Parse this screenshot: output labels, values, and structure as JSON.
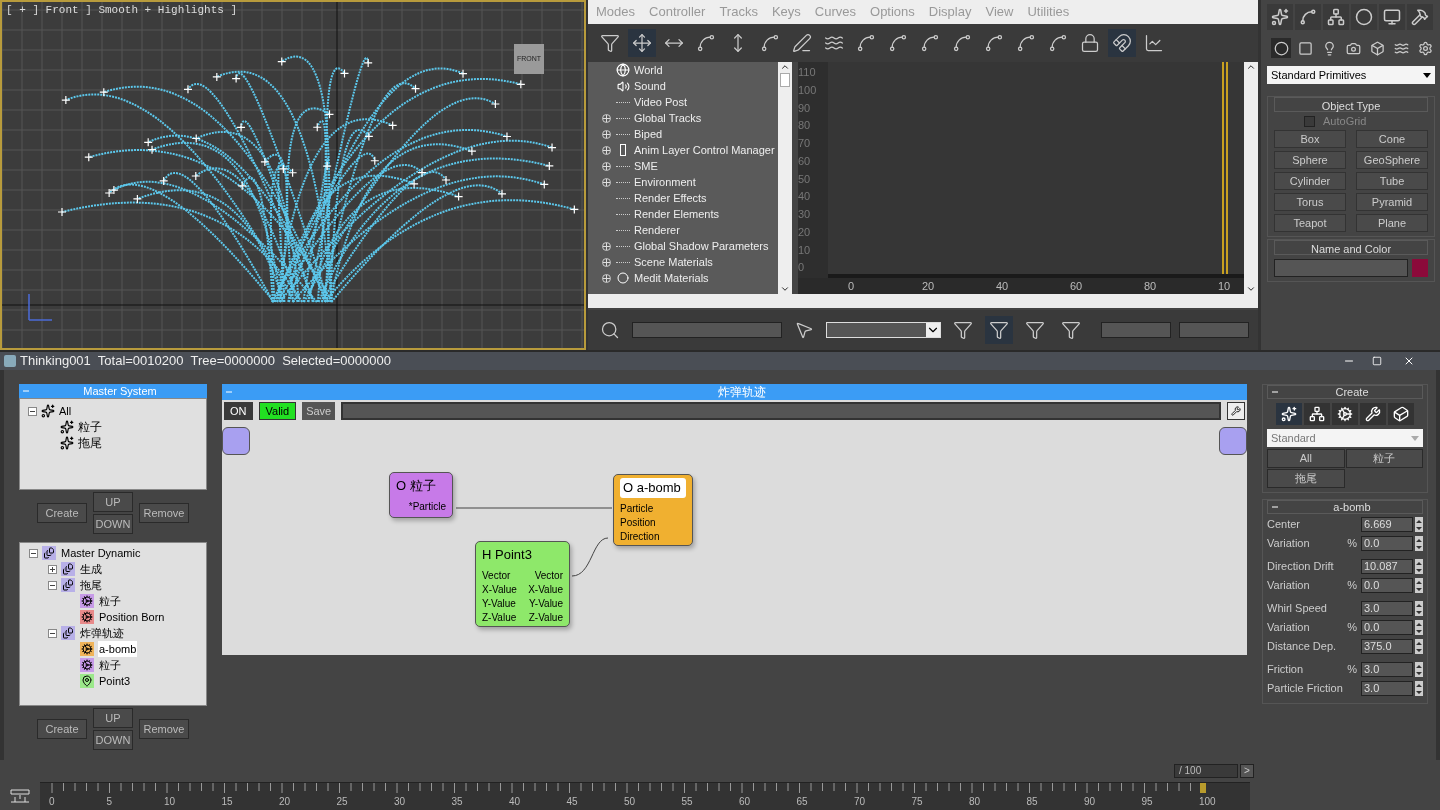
{
  "viewport": {
    "label": "[ + ] Front ] Smooth + Highlights ]",
    "viewcube": "FRONT"
  },
  "curve_editor": {
    "menu": [
      "Modes",
      "Controller",
      "Tracks",
      "Keys",
      "Curves",
      "Options",
      "Display",
      "View",
      "Utilities"
    ],
    "tree": [
      {
        "label": "World",
        "kind": "root",
        "expandable": false
      },
      {
        "label": "Sound",
        "kind": "sound",
        "expandable": false
      },
      {
        "label": "Video Post",
        "kind": "plain",
        "expandable": false
      },
      {
        "label": "Global Tracks",
        "kind": "plain",
        "expandable": true
      },
      {
        "label": "Biped",
        "kind": "plain",
        "expandable": true
      },
      {
        "label": "Anim Layer Control Manager",
        "kind": "layer",
        "expandable": true
      },
      {
        "label": "SME",
        "kind": "plain",
        "expandable": true
      },
      {
        "label": "Environment",
        "kind": "plain",
        "expandable": true
      },
      {
        "label": "Render Effects",
        "kind": "plain",
        "expandable": false
      },
      {
        "label": "Render Elements",
        "kind": "plain",
        "expandable": false
      },
      {
        "label": "Renderer",
        "kind": "plain",
        "expandable": false
      },
      {
        "label": "Global Shadow Parameters",
        "kind": "plain",
        "expandable": true
      },
      {
        "label": "Scene Materials",
        "kind": "plain",
        "expandable": true
      },
      {
        "label": "Medit Materials",
        "kind": "material",
        "expandable": true
      }
    ],
    "yticks": [
      "110",
      "100",
      "90",
      "80",
      "70",
      "60",
      "50",
      "40",
      "30",
      "20",
      "10",
      "0"
    ],
    "xticks": [
      "0",
      "20",
      "40",
      "60",
      "80",
      "10"
    ]
  },
  "command_panel": {
    "dropdown": "Standard Primitives",
    "object_type": {
      "title": "Object Type",
      "autogrid": {
        "label": "AutoGrid",
        "checked": false
      },
      "buttons": [
        "Box",
        "Cone",
        "Sphere",
        "GeoSphere",
        "Cylinder",
        "Tube",
        "Torus",
        "Pyramid",
        "Teapot",
        "Plane"
      ]
    },
    "name_and_color": {
      "title": "Name and Color",
      "color": "#8b0a3a"
    }
  },
  "tp_window": {
    "title": "Thinking001  Total=0010200  Tree=0000000  Selected=0000000",
    "master_system": {
      "title": "Master System",
      "tree": [
        {
          "label": "All",
          "expanded": true,
          "children": [
            {
              "label": "粒子"
            },
            {
              "label": "拖尾"
            }
          ]
        }
      ],
      "buttons": {
        "create": "Create",
        "up": "UP",
        "down": "DOWN",
        "remove": "Remove"
      }
    },
    "master_dynamic": {
      "tree": [
        {
          "label": "Master Dynamic",
          "kind": "dynamic",
          "expanded": true,
          "selected": false,
          "children": [
            {
              "label": "生成",
              "kind": "dynamic",
              "expanded": false,
              "selected": false
            },
            {
              "label": "拖尾",
              "kind": "dynamic",
              "expanded": true,
              "selected": false,
              "children": [
                {
                  "label": "粒子",
                  "kind": "operator",
                  "color": "#c79be8",
                  "selected": false
                },
                {
                  "label": "Position Born",
                  "kind": "operator",
                  "color": "#e88a8a",
                  "selected": false
                }
              ]
            },
            {
              "label": "炸弹轨迹",
              "kind": "dynamic",
              "expanded": true,
              "selected": false,
              "children": [
                {
                  "label": "a-bomb",
                  "kind": "operator",
                  "color": "#f0b45a",
                  "selected": true
                },
                {
                  "label": "粒子",
                  "kind": "operator",
                  "color": "#c79be8",
                  "selected": false
                },
                {
                  "label": "Point3",
                  "kind": "helper",
                  "color": "#9be88a",
                  "selected": false
                }
              ]
            }
          ]
        }
      ],
      "buttons": {
        "create": "Create",
        "up": "UP",
        "down": "DOWN",
        "remove": "Remove"
      }
    },
    "editor": {
      "title": "炸弹轨迹",
      "on": "ON",
      "valid": "Valid",
      "save": "Save",
      "nodes": [
        {
          "title": "O 粒子",
          "color": "#c77ae8",
          "outputs": [
            "*Particle"
          ]
        },
        {
          "title": "O a-bomb",
          "color": "#f0b030",
          "inputs": [
            "Particle",
            "Position",
            "Direction"
          ]
        },
        {
          "title": "H Point3",
          "color": "#8ee86a",
          "inputs": [
            "Vector",
            "X-Value",
            "Y-Value",
            "Z-Value"
          ],
          "outputs": [
            "Vector",
            "X-Value",
            "Y-Value",
            "Z-Value"
          ]
        }
      ]
    },
    "create": {
      "title": "Create",
      "dropdown": "Standard",
      "buttons": [
        "All",
        "粒子",
        "拖尾"
      ]
    },
    "params": {
      "title": "a-bomb",
      "rows": [
        {
          "label": "Center",
          "value": "6.669"
        },
        {
          "label": "Variation",
          "unit": "%",
          "value": "0.0"
        },
        {
          "label": "Direction Drift",
          "value": "10.087"
        },
        {
          "label": "Variation",
          "unit": "%",
          "value": "0.0"
        },
        {
          "label": "Whirl Speed",
          "value": "3.0"
        },
        {
          "label": "Variation",
          "unit": "%",
          "value": "0.0"
        },
        {
          "label": "Distance Dep.",
          "value": "375.0"
        },
        {
          "label": "Friction",
          "unit": "%",
          "value": "3.0"
        },
        {
          "label": "Particle Friction",
          "value": "3.0"
        }
      ]
    }
  },
  "time_slider": {
    "frame_total": "/ 100",
    "next": ">",
    "ticks": [
      "0",
      "5",
      "10",
      "15",
      "20",
      "25",
      "30",
      "35",
      "40",
      "45",
      "50",
      "55",
      "60",
      "65",
      "70",
      "75",
      "80",
      "85",
      "90",
      "95",
      "100"
    ]
  }
}
